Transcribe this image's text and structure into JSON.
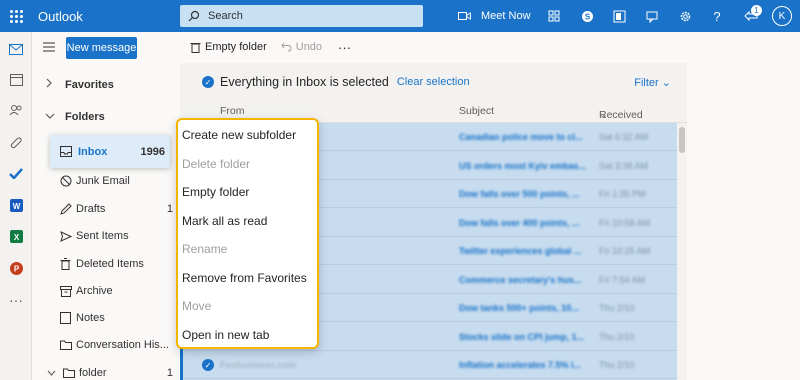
{
  "app": {
    "name": "Outlook",
    "accent": "#1a73c8"
  },
  "topbar": {
    "search_placeholder": "Search",
    "meet_now": "Meet Now",
    "notification_count": "1",
    "avatar_initial": "K"
  },
  "rail": {
    "icons": [
      "mail-icon",
      "calendar-icon",
      "people-icon",
      "attach-icon",
      "todo-icon",
      "word-icon",
      "excel-icon",
      "powerpoint-icon",
      "more-apps-icon"
    ]
  },
  "folder_pane": {
    "new_message": "New message",
    "favorites_label": "Favorites",
    "folders_label": "Folders",
    "inbox": {
      "label": "Inbox",
      "count": "1996"
    },
    "items": [
      {
        "label": "Junk Email",
        "count": ""
      },
      {
        "label": "Drafts",
        "count": "1"
      },
      {
        "label": "Sent Items",
        "count": ""
      },
      {
        "label": "Deleted Items",
        "count": ""
      },
      {
        "label": "Archive",
        "count": ""
      },
      {
        "label": "Notes",
        "count": ""
      },
      {
        "label": "Conversation His...",
        "count": ""
      },
      {
        "label": "folder",
        "count": "1"
      }
    ]
  },
  "command_bar": {
    "empty_folder": "Empty folder",
    "undo": "Undo",
    "more": "···"
  },
  "list": {
    "selection_text": "Everything in Inbox is selected",
    "clear_selection": "Clear selection",
    "filter": "Filter",
    "col_from": "From",
    "col_subject": "Subject",
    "col_received": "Received",
    "rows": [
      {
        "from": "",
        "subject": "Canadian police move to cl...",
        "date": "Sat 6:32 AM"
      },
      {
        "from": "",
        "subject": "US orders most Kyiv embas...",
        "date": "Sat 3:38 AM"
      },
      {
        "from": "",
        "subject": "Dow falls over 500 points, ...",
        "date": "Fri 1:35 PM"
      },
      {
        "from": "",
        "subject": "Dow falls over 400 points, ...",
        "date": "Fri 10:58 AM"
      },
      {
        "from": "",
        "subject": "Twitter experiences global ...",
        "date": "Fri 10:25 AM"
      },
      {
        "from": "",
        "subject": "Commerce secretary's hus...",
        "date": "Fri 7:54 AM"
      },
      {
        "from": "",
        "subject": "Dow tanks 500+ points, 10...",
        "date": "Thu 2/10"
      },
      {
        "from": "",
        "subject": "Stocks slide on CPI jump, 1...",
        "date": "Thu 2/10"
      },
      {
        "from": "Foxbusiness.com",
        "subject": "Inflation accelerates 7.5% i...",
        "date": "Thu 2/10"
      }
    ]
  },
  "context_menu": {
    "items": [
      {
        "label": "Create new subfolder",
        "enabled": true
      },
      {
        "label": "Delete folder",
        "enabled": false
      },
      {
        "label": "Empty folder",
        "enabled": true
      },
      {
        "label": "Mark all as read",
        "enabled": true
      },
      {
        "label": "Rename",
        "enabled": false
      },
      {
        "label": "Remove from Favorites",
        "enabled": true
      },
      {
        "label": "Move",
        "enabled": false
      },
      {
        "label": "Open in new tab",
        "enabled": true
      }
    ]
  }
}
